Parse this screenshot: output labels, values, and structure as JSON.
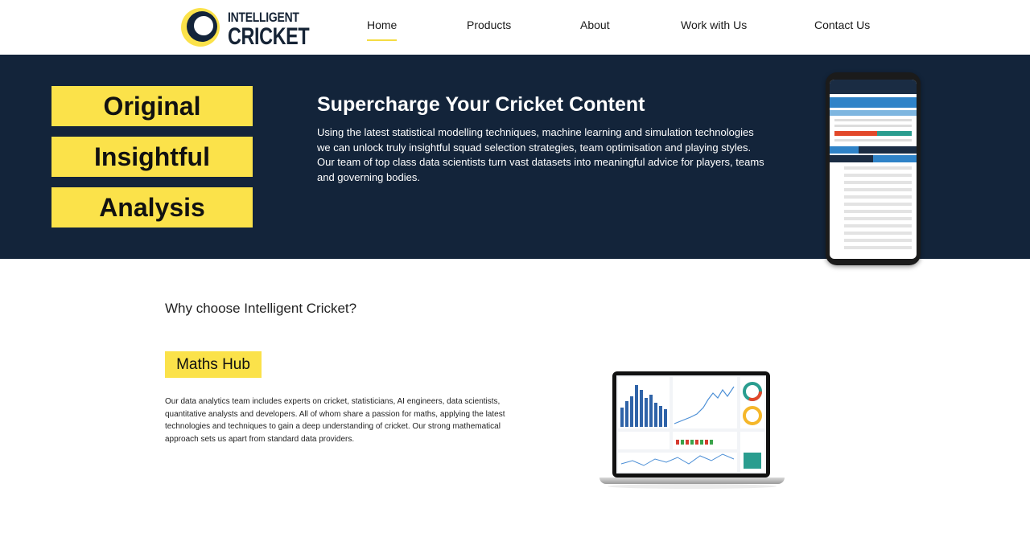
{
  "nav": {
    "logo": {
      "line1": "INTELLIGENT",
      "line2": "CRICKET"
    },
    "items": [
      {
        "label": "Home",
        "active": true
      },
      {
        "label": "Products",
        "active": false
      },
      {
        "label": "About",
        "active": false
      },
      {
        "label": "Work with Us",
        "active": false
      },
      {
        "label": "Contact Us",
        "active": false
      }
    ]
  },
  "hero": {
    "tags": [
      "Original",
      "Insightful",
      "Analysis"
    ],
    "title": "Supercharge Your Cricket Content",
    "text": "Using the latest statistical modelling techniques, machine learning and simulation technologies we can unlock truly insightful squad selection strategies, team optimisation and playing styles. Our team of top class data scientists turn vast datasets into meaningful advice for players, teams and governing bodies."
  },
  "why": {
    "heading": "Why choose Intelligent Cricket?",
    "hub_label": "Maths Hub",
    "hub_text": "Our data analytics team includes experts on cricket, statisticians, AI engineers, data scientists, quantitative analysts and developers. All of whom share a passion for maths, applying the latest technologies and techniques to gain a deep understanding of cricket. Our strong mathematical approach sets us apart from standard data providers."
  },
  "colors": {
    "navy": "#13243a",
    "yellow": "#fbe24a",
    "accent": "#f5dc43"
  }
}
